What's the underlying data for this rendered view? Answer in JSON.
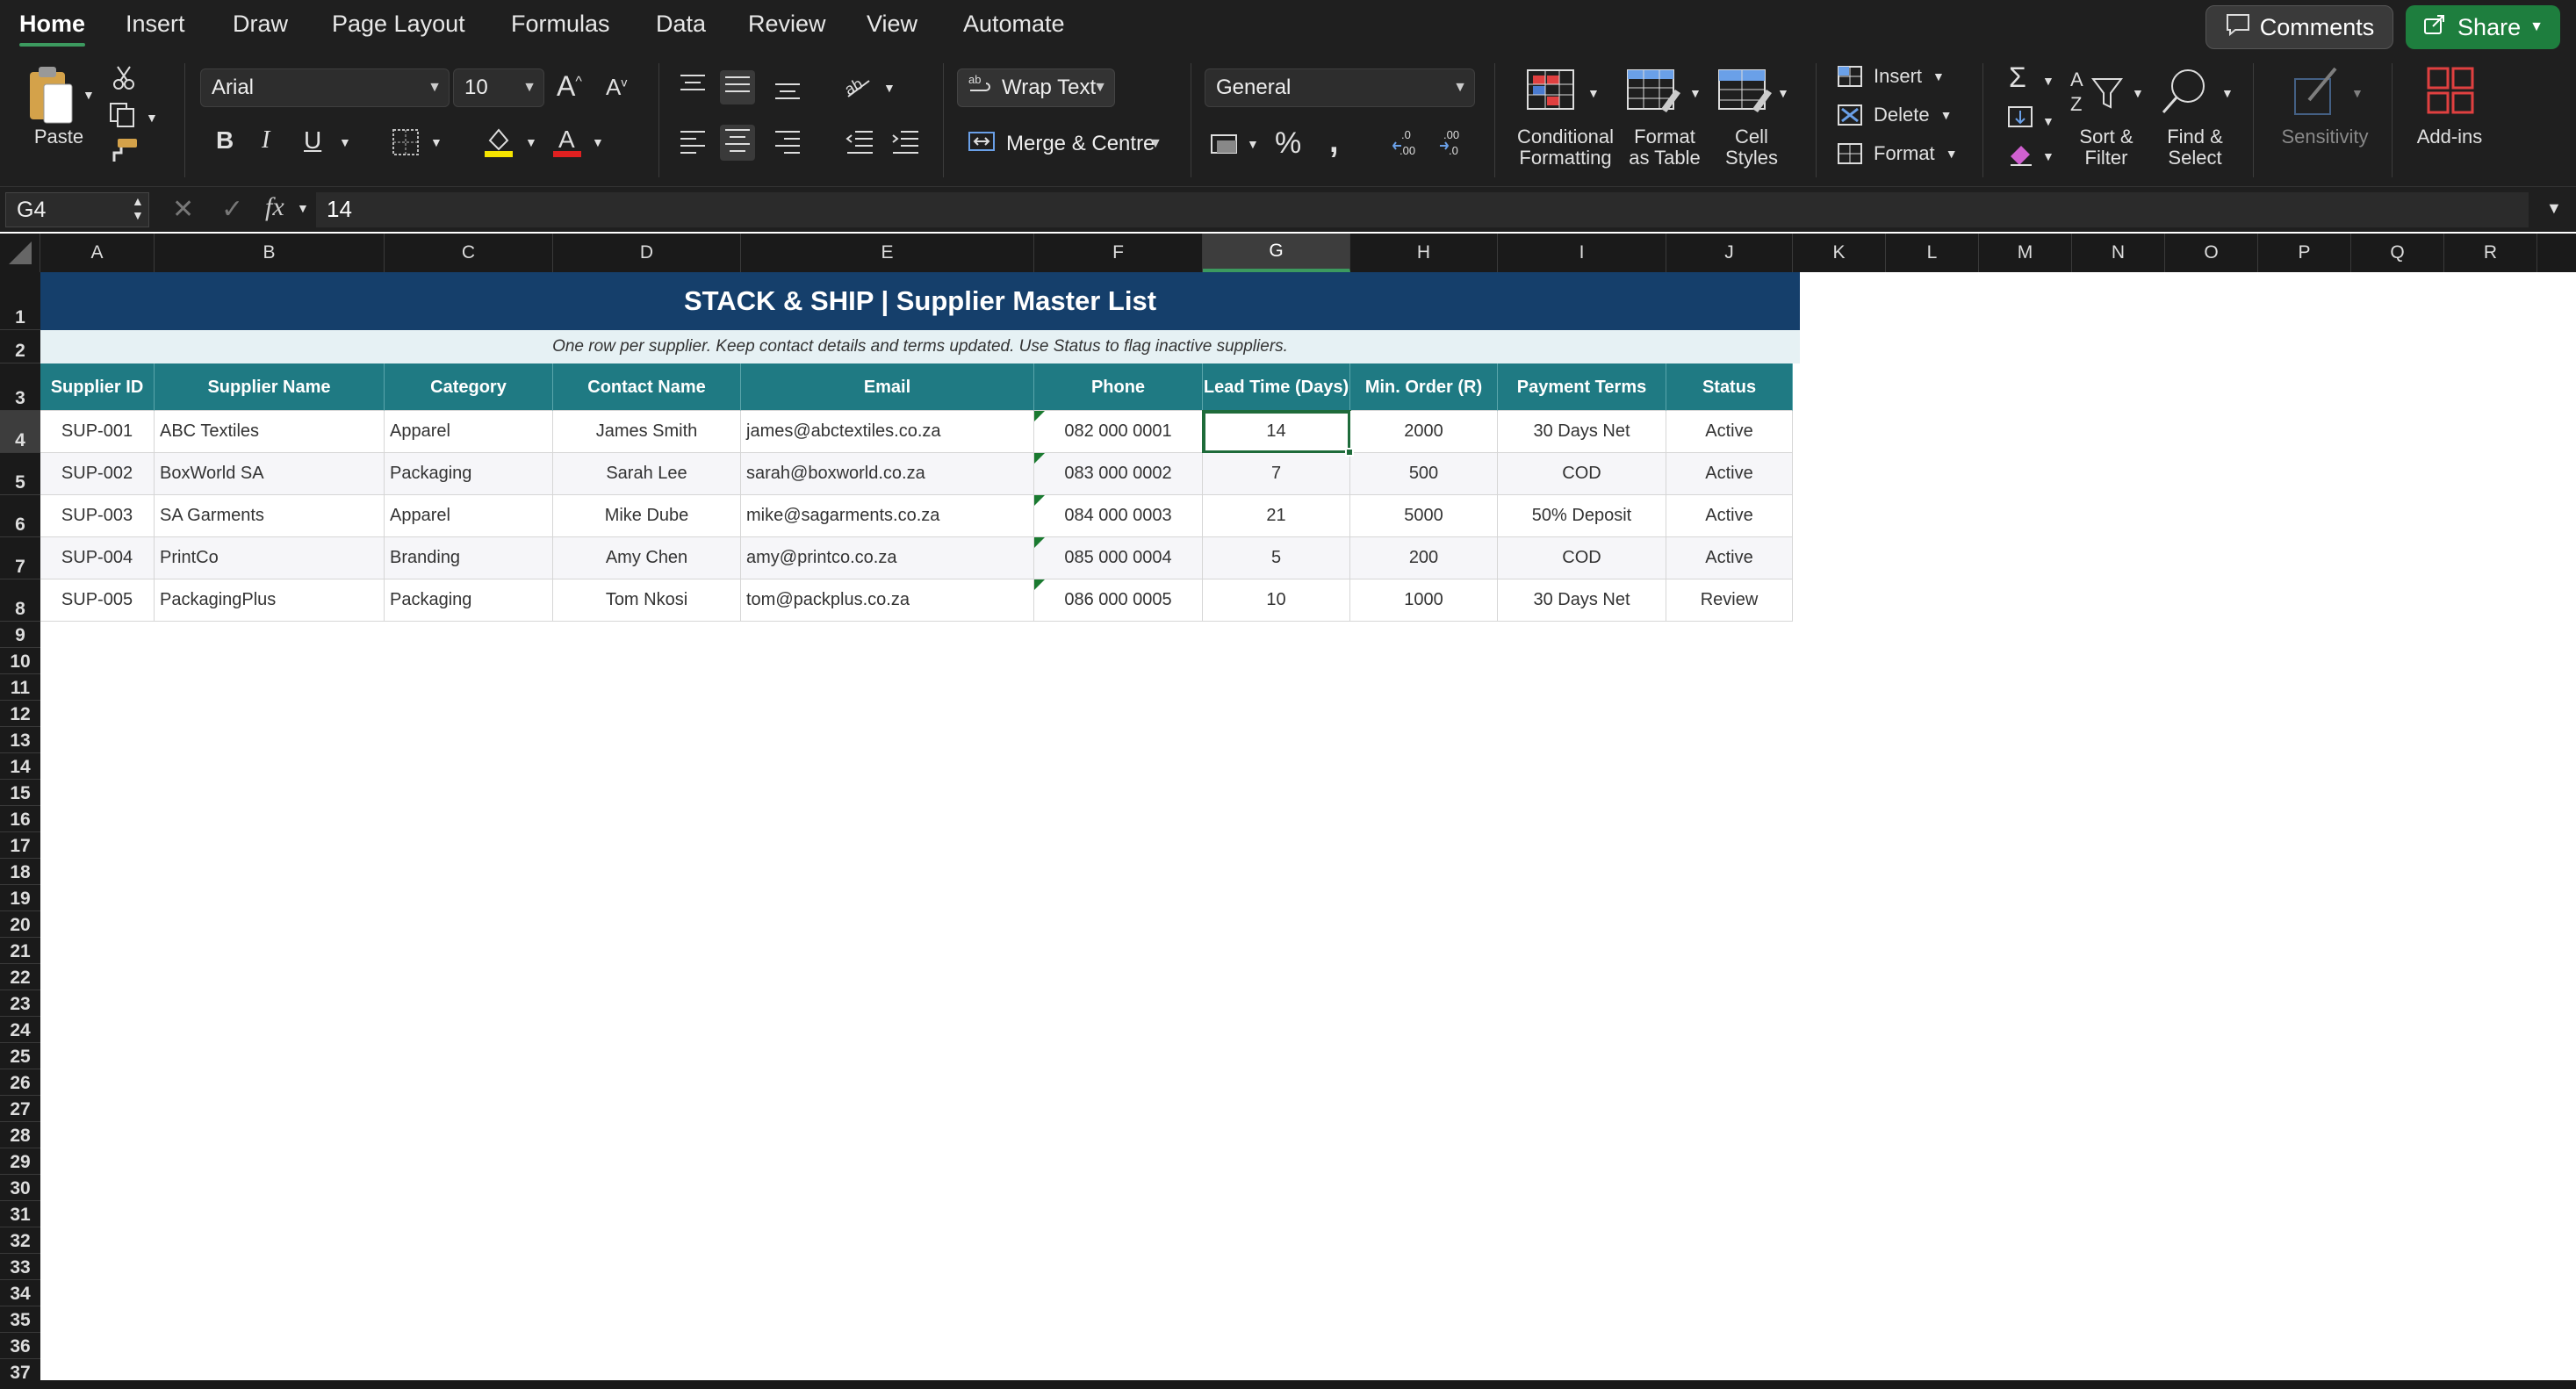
{
  "ribbon": {
    "tabs": [
      "Home",
      "Insert",
      "Draw",
      "Page Layout",
      "Formulas",
      "Data",
      "Review",
      "View",
      "Automate"
    ],
    "active_tab": "Home",
    "comments_label": "Comments",
    "share_label": "Share",
    "paste_label": "Paste",
    "font_name": "Arial",
    "font_size": "10",
    "wrap_text_label": "Wrap Text",
    "merge_label": "Merge & Centre",
    "number_format": "General",
    "cond_format_label": [
      "Conditional",
      "Formatting"
    ],
    "format_table_label": [
      "Format",
      "as Table"
    ],
    "cell_styles_label": [
      "Cell",
      "Styles"
    ],
    "insert_label": "Insert",
    "delete_label": "Delete",
    "format_label": "Format",
    "sort_filter_label": [
      "Sort &",
      "Filter"
    ],
    "find_select_label": [
      "Find &",
      "Select"
    ],
    "sensitivity_label": "Sensitivity",
    "addins_label": "Add-ins",
    "bold": "B",
    "italic": "I",
    "underline": "U"
  },
  "formula_bar": {
    "name_box": "G4",
    "value": "14",
    "fx": "fx"
  },
  "columns": [
    "A",
    "B",
    "C",
    "D",
    "E",
    "F",
    "G",
    "H",
    "I",
    "J",
    "K",
    "L",
    "M",
    "N",
    "O",
    "P",
    "Q",
    "R"
  ],
  "selected_column": "G",
  "rows": [
    "1",
    "2",
    "3",
    "4",
    "5",
    "6",
    "7",
    "8",
    "9",
    "10",
    "11",
    "12",
    "13",
    "14",
    "15",
    "16",
    "17",
    "18",
    "19",
    "20",
    "21",
    "22",
    "23",
    "24",
    "25",
    "26",
    "27",
    "28",
    "29",
    "30",
    "31",
    "32",
    "33",
    "34",
    "35",
    "36",
    "37"
  ],
  "selected_row": "4",
  "sheet": {
    "title": "STACK & SHIP  |  Supplier Master List",
    "subtitle": "One row per supplier. Keep contact details and terms updated. Use Status to flag inactive suppliers.",
    "headers": [
      "Supplier ID",
      "Supplier Name",
      "Category",
      "Contact Name",
      "Email",
      "Phone",
      "Lead Time (Days)",
      "Min. Order (R)",
      "Payment Terms",
      "Status"
    ],
    "data": [
      [
        "SUP-001",
        "ABC Textiles",
        "Apparel",
        "James Smith",
        "james@abctextiles.co.za",
        "082 000 0001",
        "14",
        "2000",
        "30 Days Net",
        "Active"
      ],
      [
        "SUP-002",
        "BoxWorld SA",
        "Packaging",
        "Sarah Lee",
        "sarah@boxworld.co.za",
        "083 000 0002",
        "7",
        "500",
        "COD",
        "Active"
      ],
      [
        "SUP-003",
        "SA Garments",
        "Apparel",
        "Mike Dube",
        "mike@sagarments.co.za",
        "084 000 0003",
        "21",
        "5000",
        "50% Deposit",
        "Active"
      ],
      [
        "SUP-004",
        "PrintCo",
        "Branding",
        "Amy Chen",
        "amy@printco.co.za",
        "085 000 0004",
        "5",
        "200",
        "COD",
        "Active"
      ],
      [
        "SUP-005",
        "PackagingPlus",
        "Packaging",
        "Tom Nkosi",
        "tom@packplus.co.za",
        "086 000 0005",
        "10",
        "1000",
        "30 Days Net",
        "Review"
      ]
    ]
  },
  "colors": {
    "title_bg": "#153f6b",
    "header_bg": "#1f7a83",
    "accent": "#1e6b3a"
  }
}
